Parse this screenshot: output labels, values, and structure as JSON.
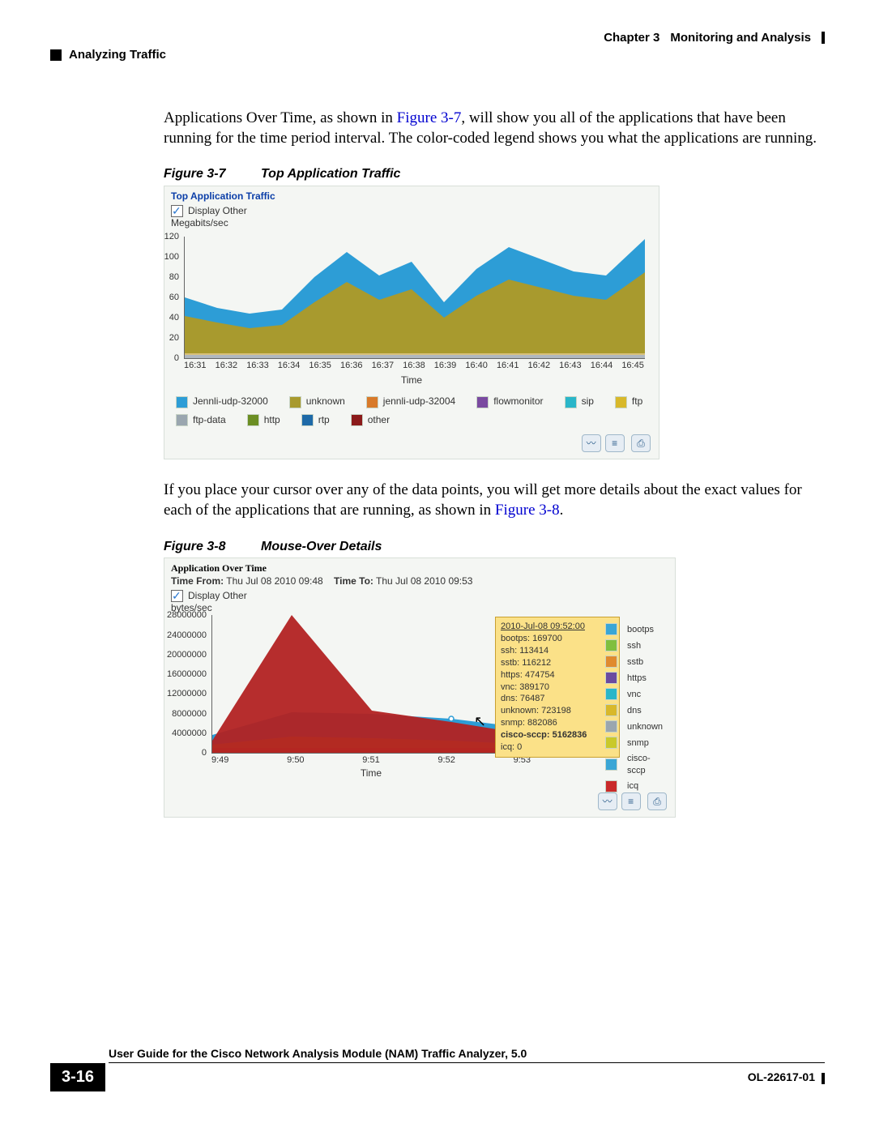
{
  "header": {
    "chapter": "Chapter 3",
    "chapter_title": "Monitoring and Analysis",
    "section": "Analyzing Traffic"
  },
  "body": {
    "para1a": "Applications Over Time, as shown in ",
    "fig7ref": "Figure 3-7",
    "para1b": ", will show you all of the applications that have been running for the time period interval. The color-coded legend shows you what the applications are running.",
    "para2a": "If you place your cursor over any of the data points, you will get more details about the exact values for each of the applications that are running, as shown in ",
    "fig8ref": "Figure 3-8",
    "para2b": "."
  },
  "fig7": {
    "caption_num": "Figure 3-7",
    "caption_title": "Top Application Traffic",
    "title": "Top Application Traffic",
    "display_other": "Display Other",
    "y_unit": "Megabits/sec",
    "x_label": "Time",
    "legend": [
      "Jennli-udp-32000",
      "unknown",
      "jennli-udp-32004",
      "flowmonitor",
      "sip",
      "ftp",
      "ftp-data",
      "http",
      "rtp",
      "other"
    ]
  },
  "fig8": {
    "caption_num": "Figure 3-8",
    "caption_title": "Mouse-Over Details",
    "title": "Application Over Time",
    "time_from_label": "Time From:",
    "time_from": "Thu Jul 08 2010 09:48",
    "time_to_label": "Time To:",
    "time_to": "Thu Jul 08 2010 09:53",
    "display_other": "Display Other",
    "y_unit": "bytes/sec",
    "x_label": "Time",
    "tooltip_ts": "2010-Jul-08 09:52:00",
    "tooltip": [
      "bootps: 169700",
      "ssh: 113414",
      "sstb: 116212",
      "https: 474754",
      "vnc: 389170",
      "dns: 76487",
      "unknown: 723198",
      "snmp: 882086"
    ],
    "tooltip_bold": "cisco-sccp: 5162836",
    "tooltip_last": "icq: 0",
    "legend": [
      "bootps",
      "ssh",
      "sstb",
      "https",
      "vnc",
      "dns",
      "unknown",
      "snmp",
      "cisco-sccp",
      "icq"
    ]
  },
  "footer": {
    "title": "User Guide for the Cisco Network Analysis Module (NAM) Traffic Analyzer, 5.0",
    "page": "3-16",
    "doc": "OL-22617-01"
  },
  "chart_data": [
    {
      "type": "area",
      "title": "Top Application Traffic",
      "xlabel": "Time",
      "ylabel": "Megabits/sec",
      "ylim": [
        0,
        120
      ],
      "x": [
        "16:31",
        "16:32",
        "16:33",
        "16:34",
        "16:35",
        "16:36",
        "16:37",
        "16:38",
        "16:39",
        "16:40",
        "16:41",
        "16:42",
        "16:43",
        "16:44",
        "16:45"
      ],
      "series": [
        {
          "name": "Jennli-udp-32000",
          "color": "#2d9dd6",
          "values": [
            60,
            50,
            44,
            48,
            80,
            105,
            82,
            95,
            55,
            88,
            110,
            98,
            86,
            82,
            118
          ]
        },
        {
          "name": "unknown",
          "color": "#a89a2e",
          "values": [
            42,
            35,
            30,
            33,
            55,
            75,
            58,
            68,
            40,
            62,
            78,
            70,
            62,
            58,
            85
          ]
        },
        {
          "name": "jennli-udp-32004",
          "color": "#d87a2a",
          "values": [
            3,
            3,
            3,
            3,
            3,
            3,
            3,
            3,
            3,
            3,
            3,
            3,
            3,
            3,
            3
          ]
        },
        {
          "name": "flowmonitor",
          "color": "#7a4aa0",
          "values": [
            2,
            2,
            2,
            2,
            2,
            2,
            2,
            2,
            2,
            2,
            2,
            2,
            2,
            2,
            2
          ]
        },
        {
          "name": "sip",
          "color": "#2ab6c9",
          "values": [
            1,
            1,
            1,
            1,
            1,
            1,
            1,
            1,
            1,
            1,
            1,
            1,
            1,
            1,
            1
          ]
        },
        {
          "name": "ftp",
          "color": "#d8b82a",
          "values": [
            1,
            1,
            1,
            1,
            1,
            1,
            1,
            1,
            1,
            1,
            1,
            1,
            1,
            1,
            1
          ]
        },
        {
          "name": "ftp-data",
          "color": "#9aa6af",
          "values": [
            1,
            1,
            1,
            1,
            1,
            1,
            1,
            1,
            1,
            1,
            1,
            1,
            1,
            1,
            1
          ]
        },
        {
          "name": "http",
          "color": "#6b8e23",
          "values": [
            1,
            1,
            1,
            1,
            1,
            1,
            1,
            1,
            1,
            1,
            1,
            1,
            1,
            1,
            1
          ]
        },
        {
          "name": "rtp",
          "color": "#1e6aa8",
          "values": [
            1,
            1,
            1,
            1,
            1,
            1,
            1,
            1,
            1,
            1,
            1,
            1,
            1,
            1,
            1
          ]
        },
        {
          "name": "other",
          "color": "#8b1a1a",
          "values": [
            1,
            1,
            1,
            1,
            1,
            1,
            1,
            1,
            1,
            1,
            1,
            1,
            1,
            1,
            1
          ]
        }
      ]
    },
    {
      "type": "area",
      "title": "Application Over Time",
      "xlabel": "Time",
      "ylabel": "bytes/sec",
      "ylim": [
        0,
        28000000
      ],
      "x": [
        "9:49",
        "9:50",
        "9:51",
        "9:52",
        "9:53"
      ],
      "yticks": [
        0,
        4000000,
        8000000,
        12000000,
        16000000,
        20000000,
        24000000,
        28000000
      ],
      "series": [
        {
          "name": "bootps",
          "color": "#3aa6d6",
          "values": [
            169700,
            169700,
            169700,
            169700,
            169700
          ]
        },
        {
          "name": "ssh",
          "color": "#7fbf3f",
          "values": [
            113414,
            113414,
            113414,
            113414,
            113414
          ]
        },
        {
          "name": "sstb",
          "color": "#e08a2e",
          "values": [
            116212,
            116212,
            116212,
            116212,
            116212
          ]
        },
        {
          "name": "https",
          "color": "#6a4aa0",
          "values": [
            474754,
            474754,
            474754,
            474754,
            474754
          ]
        },
        {
          "name": "vnc",
          "color": "#2ab6c9",
          "values": [
            389170,
            389170,
            389170,
            389170,
            389170
          ]
        },
        {
          "name": "dns",
          "color": "#d8b82a",
          "values": [
            76487,
            76487,
            76487,
            76487,
            76487
          ]
        },
        {
          "name": "unknown",
          "color": "#9aa6af",
          "values": [
            723198,
            723198,
            723198,
            723198,
            723198
          ]
        },
        {
          "name": "snmp",
          "color": "#c9c92a",
          "values": [
            882086,
            882086,
            882086,
            882086,
            882086
          ]
        },
        {
          "name": "cisco-sccp",
          "color": "#b22222",
          "values": [
            4000000,
            28000000,
            9000000,
            5162836,
            4000000
          ]
        },
        {
          "name": "icq",
          "color": "#c92a2a",
          "values": [
            0,
            0,
            0,
            0,
            0
          ]
        }
      ]
    }
  ]
}
